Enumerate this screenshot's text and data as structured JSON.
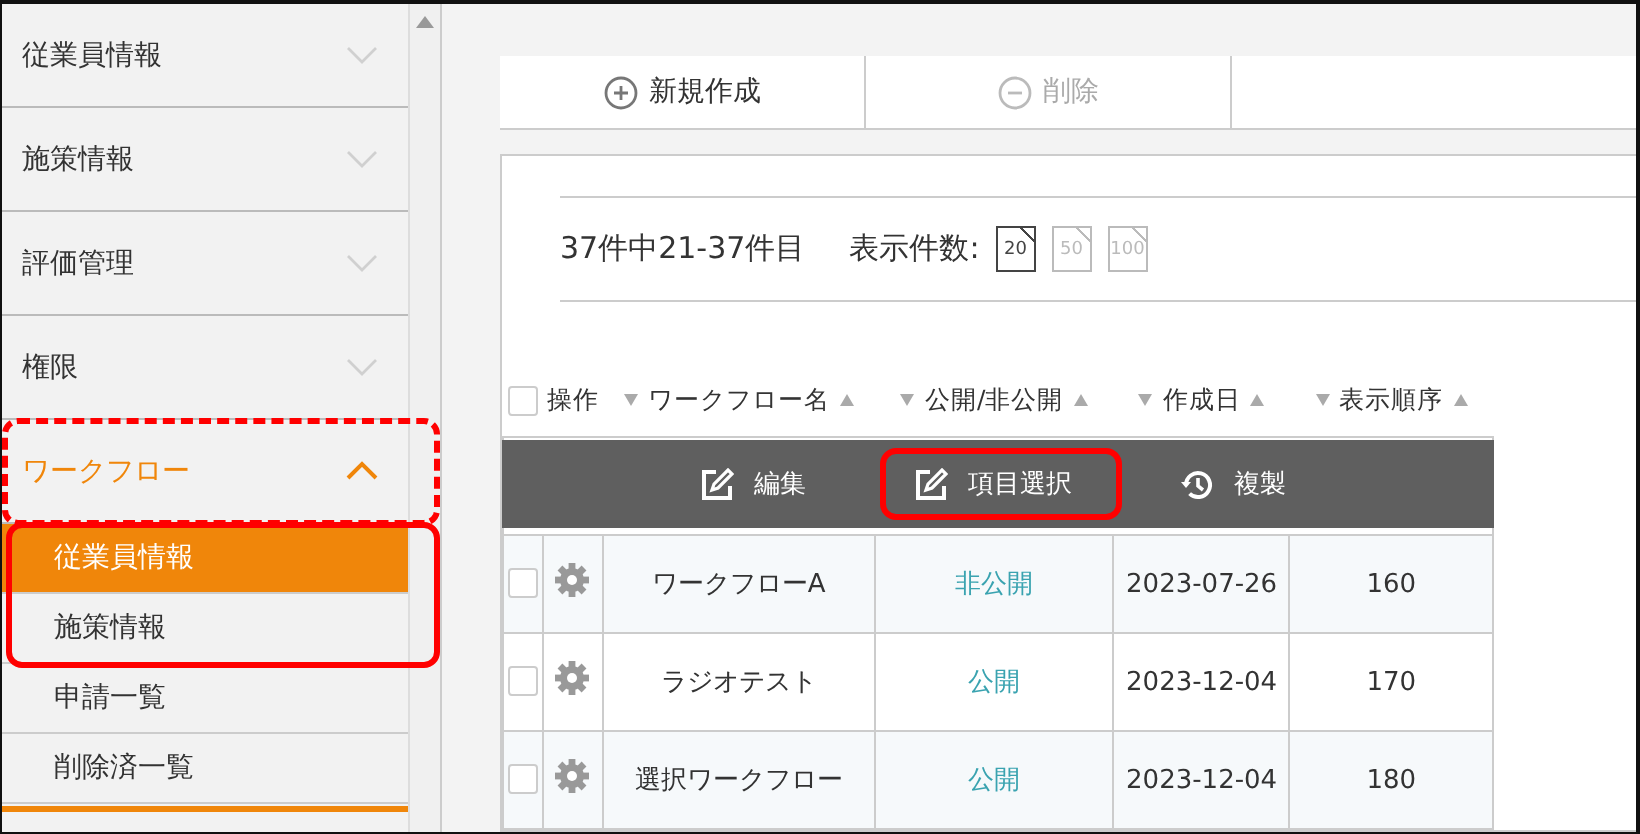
{
  "sidebar": {
    "items": [
      {
        "label": "従業員情報",
        "expanded": false
      },
      {
        "label": "施策情報",
        "expanded": false
      },
      {
        "label": "評価管理",
        "expanded": false
      },
      {
        "label": "権限",
        "expanded": false
      },
      {
        "label": "ワークフロー",
        "expanded": true,
        "highlighted": true,
        "highlight_dashed": true,
        "children_highlighted": true,
        "children": [
          {
            "label": "従業員情報",
            "selected": true
          },
          {
            "label": "施策情報",
            "selected": false
          }
        ]
      },
      {
        "label": "申請一覧",
        "kind": "sub",
        "selected": false
      },
      {
        "label": "削除済一覧",
        "kind": "sub",
        "selected": false
      }
    ]
  },
  "toolbar": [
    {
      "label": "新規作成",
      "kind": "add",
      "disabled": false
    },
    {
      "label": "削除",
      "kind": "remove",
      "disabled": true
    }
  ],
  "range_text": "37件中21-37件目",
  "page_size": {
    "label": "表示件数:",
    "options": [
      {
        "label": "20",
        "selected": true
      },
      {
        "label": "50",
        "selected": false
      },
      {
        "label": "100",
        "selected": false
      }
    ]
  },
  "table": {
    "all_checked": false,
    "columns": [
      "操作",
      "ワークフロー名",
      "公開/非公開",
      "作成日",
      "表示順序"
    ],
    "row_actions": [
      {
        "label": "編集",
        "kind": "edit",
        "highlighted": false
      },
      {
        "label": "項目選択",
        "kind": "edit",
        "highlighted": true
      },
      {
        "label": "複製",
        "kind": "history",
        "highlighted": false
      }
    ],
    "rows": [
      {
        "checked": false,
        "name": "ワークフローA",
        "status": "非公開",
        "created": "2023-07-26",
        "order": "160"
      },
      {
        "checked": false,
        "name": "ラジオテスト",
        "status": "公開",
        "created": "2023-12-04",
        "order": "170"
      },
      {
        "checked": false,
        "name": "選択ワークフロー",
        "status": "公開",
        "created": "2023-12-04",
        "order": "180"
      }
    ]
  }
}
